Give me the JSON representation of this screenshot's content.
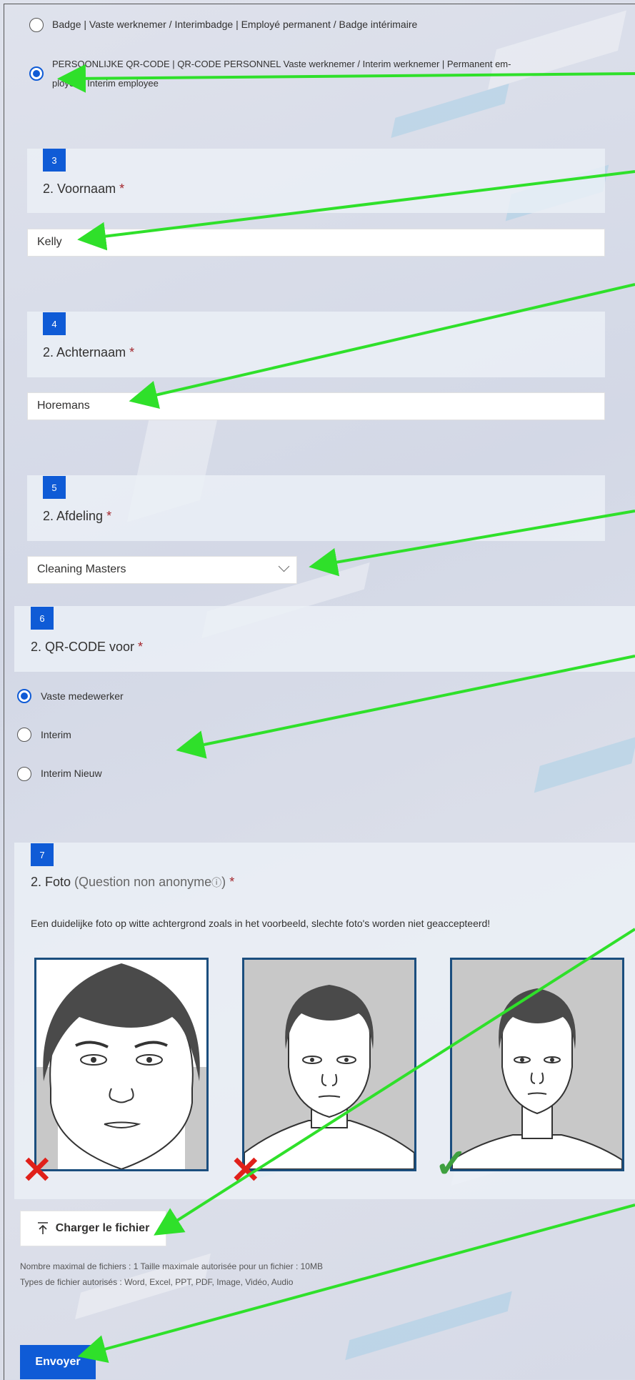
{
  "q1": {
    "options": [
      {
        "label": "Badge | Vaste werknemer / Interimbadge | Employé permanent / Badge intérimaire",
        "selected": false
      },
      {
        "label_line1": "PERSOONLIJKE QR-CODE | QR-CODE PERSONNEL  Vaste werknemer / Interim werknemer | Permanent em-",
        "label_line2": "ployee / Interim employee",
        "selected": true
      }
    ]
  },
  "q3": {
    "number": "3",
    "title": "2. Voornaam",
    "required": "*",
    "value": "Kelly"
  },
  "q4": {
    "number": "4",
    "title": "2. Achternaam",
    "required": "*",
    "value": "Horemans"
  },
  "q5": {
    "number": "5",
    "title": "2. Afdeling",
    "required": "*",
    "value": "Cleaning Masters"
  },
  "q6": {
    "number": "6",
    "title": "2. QR-CODE voor",
    "required": "*",
    "options": [
      {
        "label": "Vaste medewerker",
        "selected": true
      },
      {
        "label": "Interim",
        "selected": false
      },
      {
        "label": "Interim Nieuw",
        "selected": false
      }
    ]
  },
  "q7": {
    "number": "7",
    "title": "2. Foto",
    "subtitle": "(Question non anonyme",
    "info_glyph": "ⓘ",
    "subtitle_end": ")",
    "required": "*",
    "description": "Een duidelijke foto op witte achtergrond zoals in het voorbeeld, slechte foto's worden niet geaccepteerd!",
    "examples": [
      "bad-closeup",
      "bad-shoulders",
      "good-framing"
    ],
    "marks": [
      "✕",
      "✕",
      "✓"
    ]
  },
  "upload": {
    "label": "Charger le fichier",
    "icon": "upload-icon",
    "limits_line1": "Nombre maximal de fichiers : 1   Taille maximale autorisée pour un fichier : 10MB",
    "limits_line2": "Types de fichier autorisés : Word, Excel, PPT, PDF, Image, Vidéo, Audio"
  },
  "submit": {
    "label": "Envoyer"
  },
  "colors": {
    "accent": "#0f5bd6",
    "arrow": "#2fe02a",
    "required": "#a4262c",
    "bad": "#e0201a",
    "good": "#3fa03f"
  }
}
